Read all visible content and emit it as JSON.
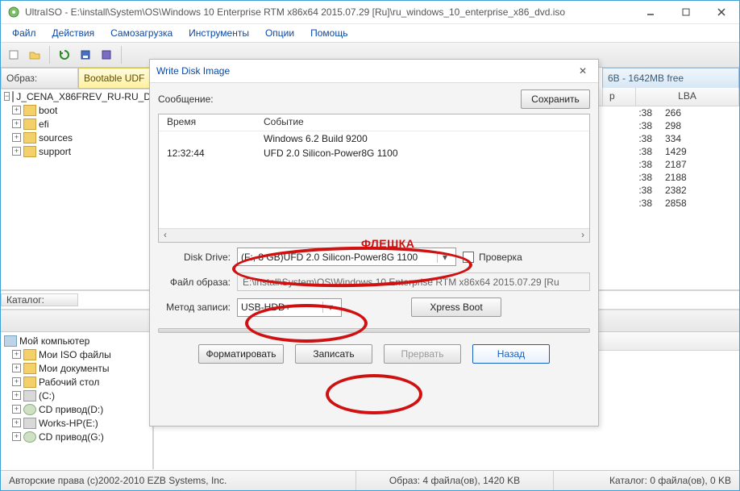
{
  "window": {
    "title": "UltraISO - E:\\install\\System\\OS\\Windows 10 Enterprise RTM x86x64 2015.07.29 [Ru]\\ru_windows_10_enterprise_x86_dvd.iso"
  },
  "menu": [
    "Файл",
    "Действия",
    "Самозагрузка",
    "Инструменты",
    "Опции",
    "Помощь"
  ],
  "strip": {
    "obraz_label": "Образ:",
    "obraz_value": "Bootable UDF",
    "capacity": "6B - 1642MB free"
  },
  "tree_top": {
    "root": "J_CENA_X86FREV_RU-RU_D",
    "items": [
      "boot",
      "efi",
      "sources",
      "support"
    ]
  },
  "file_cols": {
    "size": "p",
    "lba": "LBA",
    "time_tail": ":38"
  },
  "file_rows": [
    {
      "lba": "266"
    },
    {
      "lba": "298"
    },
    {
      "lba": "334"
    },
    {
      "lba": "1429"
    },
    {
      "lba": "2187"
    },
    {
      "lba": "2188"
    },
    {
      "lba": "2382"
    },
    {
      "lba": "2858"
    }
  ],
  "catalog": {
    "label": "Каталог:",
    "root": "Мой компьютер",
    "items": [
      {
        "label": "Мои ISO файлы",
        "icon": "folder"
      },
      {
        "label": "Мои документы",
        "icon": "folder"
      },
      {
        "label": "Рабочий стол",
        "icon": "folder"
      },
      {
        "label": "(C:)",
        "icon": "drive"
      },
      {
        "label": "CD привод(D:)",
        "icon": "cd"
      },
      {
        "label": "Works-HP(E:)",
        "icon": "drive"
      },
      {
        "label": "CD привод(G:)",
        "icon": "cd"
      }
    ]
  },
  "status": {
    "copyright": "Авторские права (c)2002-2010 EZB Systems, Inc.",
    "mid": "Образ: 4 файла(ов), 1420 KB",
    "right": "Каталог: 0 файла(ов), 0 KB"
  },
  "dialog": {
    "title": "Write Disk Image",
    "msg_label": "Сообщение:",
    "save": "Сохранить",
    "col_time": "Время",
    "col_event": "Событие",
    "row1_event": "Windows 6.2 Build 9200",
    "row2_time": "12:32:44",
    "row2_event": "UFD 2.0 Silicon-Power8G 1100",
    "flashka": "ФЛЕШКА",
    "drive_label": "Disk Drive:",
    "drive_value": "(F:, 8 GB)UFD 2.0 Silicon-Power8G 1100",
    "verify": "Проверка",
    "image_label": "Файл образа:",
    "image_value": "E:\\install\\System\\OS\\Windows 10 Enterprise RTM x86x64 2015.07.29 [Ru",
    "method_label": "Метод записи:",
    "method_value": "USB-HDD+",
    "xpress": "Xpress Boot",
    "format": "Форматировать",
    "write": "Записать",
    "abort": "Прервать",
    "back": "Назад"
  }
}
